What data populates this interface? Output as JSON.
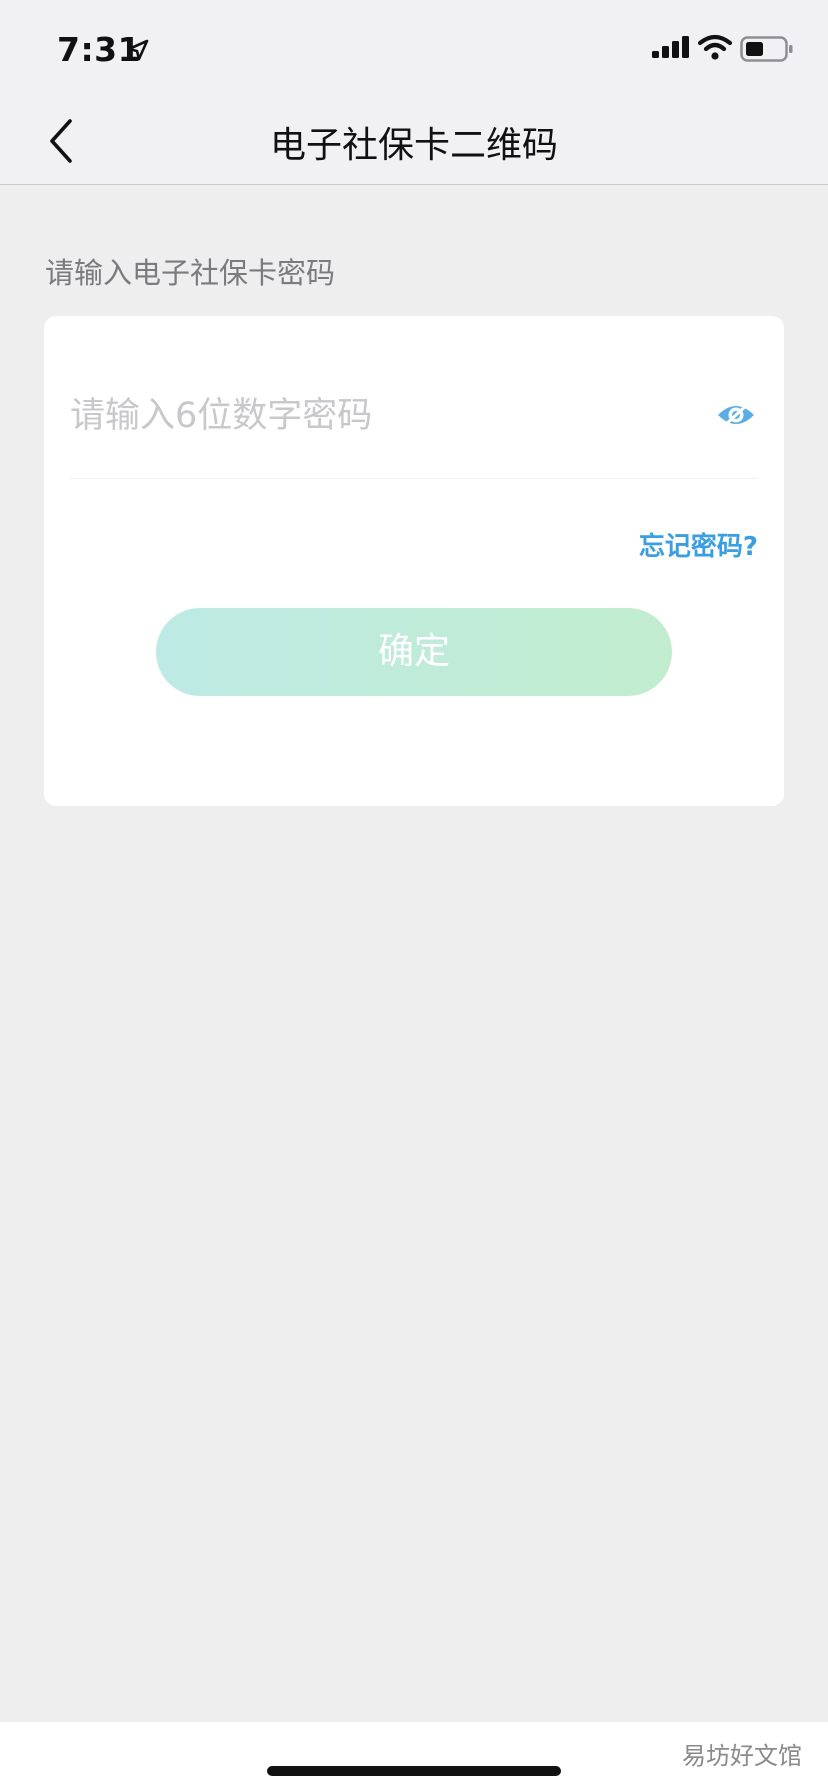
{
  "status_bar": {
    "time": "7:31",
    "icons": [
      "location-arrow-icon",
      "cellular-signal-icon",
      "wifi-icon",
      "battery-icon"
    ]
  },
  "nav": {
    "back_icon": "chevron-left-icon",
    "title": "电子社保卡二维码"
  },
  "form": {
    "section_label": "请输入电子社保卡密码",
    "password_value": "",
    "password_placeholder": "请输入6位数字密码",
    "visibility_icon": "eye-icon",
    "forgot_label": "忘记密码?",
    "confirm_label": "确定"
  },
  "watermark": "易坊好文馆",
  "colors": {
    "accent_link": "#3a9fe0",
    "button_gradient_start": "#bdeae4",
    "button_gradient_end": "#c1ecce",
    "background": "#eeeeef"
  }
}
